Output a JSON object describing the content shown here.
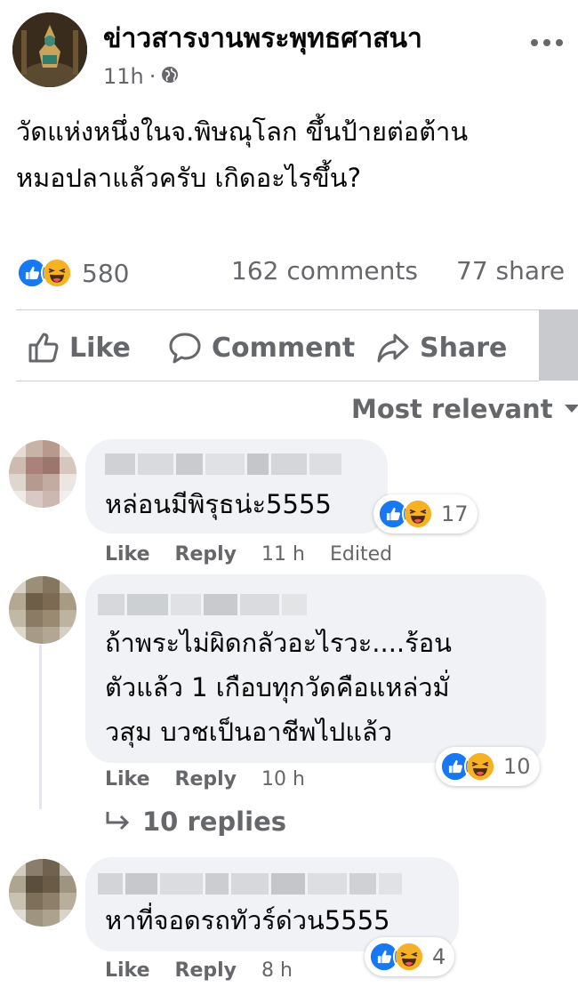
{
  "post": {
    "page_name": "ข่าวสารงานพระพุทธศาสนา",
    "time": "11h",
    "audience_icon": "globe-icon",
    "more_icon": "more-options-icon",
    "text_lines": [
      "วัดแห่งหนึ่งในจ.พิษณุโลก ขึ้นป้ายต่อต้าน",
      "หมอปลาแล้วครับ เกิดอะไรขึ้น?"
    ],
    "reaction_icons": [
      "like-icon",
      "haha-icon"
    ],
    "reaction_count": "580",
    "comments_count": "162 comments",
    "shares_count": "77 share"
  },
  "actions": {
    "like": "Like",
    "comment": "Comment",
    "share": "Share"
  },
  "sort_label": "Most relevant",
  "comments": [
    {
      "text_lines": [
        "หล่อนมีพิรุธน่ะ5555"
      ],
      "reactions": "17",
      "like": "Like",
      "reply": "Reply",
      "time": "11 h",
      "edited": "Edited"
    },
    {
      "text_lines": [
        "ถ้าพระไม่ผิดกลัวอะไรวะ....ร้อน",
        "ตัวแล้ว 1 เกือบทุกวัดคือแหล่วมั่",
        "วสุม บวชเป็นอาชีพไปแล้ว"
      ],
      "reactions": "10",
      "like": "Like",
      "reply": "Reply",
      "time": "10 h",
      "replies": "10 replies"
    },
    {
      "text_lines": [
        "หาที่จอดรถทัวร์ด่วน5555"
      ],
      "reactions": "4",
      "like": "Like",
      "reply": "Reply",
      "time": "8 h"
    }
  ],
  "colors": {
    "text": "#050505",
    "muted": "#65676b",
    "bubble": "#f0f2f5",
    "like_blue": "#1877f2",
    "haha_yellow": "#f7b125"
  }
}
